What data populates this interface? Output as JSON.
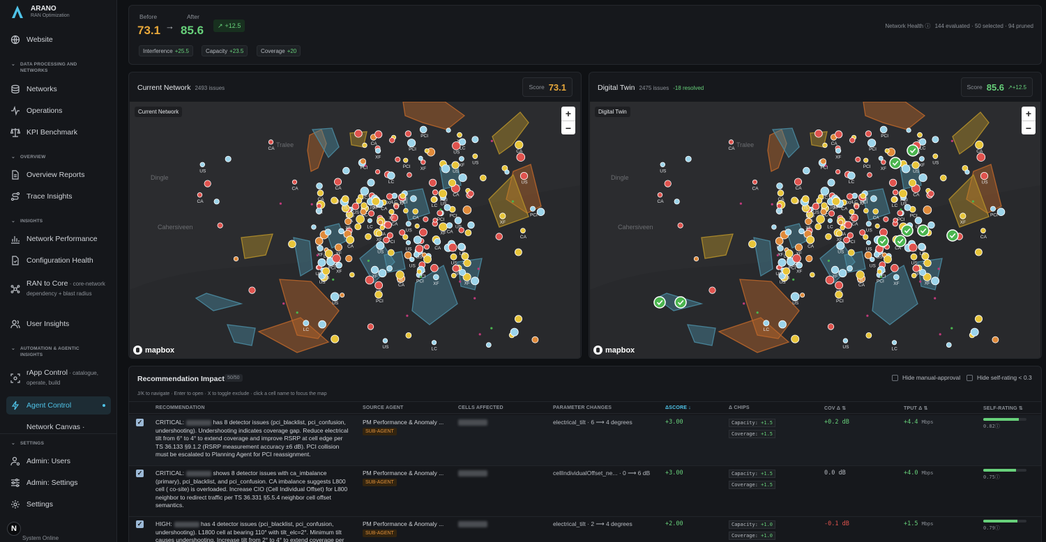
{
  "brand": {
    "name": "ARANO",
    "subtitle": "RAN Optimization"
  },
  "sidebar": {
    "website": "Website",
    "sections": [
      {
        "label": "DATA PROCESSING AND NETWORKS"
      },
      {
        "label": "OVERVIEW"
      },
      {
        "label": "INSIGHTS"
      },
      {
        "label": "AUTOMATION & AGENTIC INSIGHTS"
      },
      {
        "label": "SETTINGS"
      }
    ],
    "items": {
      "networks": "Networks",
      "operations": "Operations",
      "kpi": "KPI Benchmark",
      "overview_reports": "Overview Reports",
      "trace_insights": "Trace Insights",
      "network_performance": "Network Performance",
      "configuration_health": "Configuration Health",
      "ran_to_core": "RAN to Core",
      "ran_to_core_desc": " · core-network dependency + blast radius",
      "user_insights": "User Insights",
      "rapp_control": "rApp Control",
      "rapp_control_desc": " · catalogue, operate, build",
      "agent_control": "Agent Control",
      "network_canvas": "Network Canvas ·",
      "admin_users": "Admin: Users",
      "admin_settings": "Admin: Settings",
      "settings": "Settings"
    },
    "status": "System Online",
    "avatar": "N"
  },
  "summary": {
    "before_label": "Before",
    "before_value": "73.1",
    "after_label": "After",
    "after_value": "85.6",
    "delta": "+12.5",
    "chips": [
      {
        "label": "Interference",
        "value": "+25.5"
      },
      {
        "label": "Capacity",
        "value": "+23.5"
      },
      {
        "label": "Coverage",
        "value": "+20"
      }
    ],
    "network_health_label": "Network Health",
    "network_health_stats": "144 evaluated · 50 selected · 94 pruned"
  },
  "maps": {
    "current": {
      "title": "Current Network",
      "issues": "2493 issues",
      "score_label": "Score",
      "score": "73.1",
      "tag": "Current Network"
    },
    "twin": {
      "title": "Digital Twin",
      "issues": "2475 issues",
      "resolved": "-18 resolved",
      "score_label": "Score",
      "score": "85.6",
      "delta": "+12.5",
      "tag": "Digital Twin"
    },
    "place_labels": [
      "Tralee",
      "Dingle",
      "Cahersiveen"
    ],
    "zoom_in": "+",
    "zoom_out": "−",
    "attribution": "mapbox",
    "colors": {
      "red": "#e0534e",
      "orange": "#e08a3a",
      "yellow": "#e8c53a",
      "blue": "#9cd4ea",
      "green": "#4bb54f",
      "poly_blue": "#4a8aa0",
      "poly_yellow": "#b38f2a",
      "poly_orange": "#b8652a"
    }
  },
  "rec": {
    "title": "Recommendation Impact",
    "count": "50/50",
    "hint": "J/K to navigate · Enter to open · X to toggle exclude · click a cell name to focus the map",
    "hide_manual": "Hide manual-approval",
    "hide_self": "Hide self-rating < 0.3",
    "headers": {
      "recommendation": "RECOMMENDATION",
      "source": "SOURCE AGENT",
      "cells": "CELLS AFFECTED",
      "params": "PARAMETER CHANGES",
      "score": "ΔSCORE ↓",
      "chips": "Δ CHIPS",
      "cov": "COV Δ ⇅",
      "tput": "TPUT Δ ⇅",
      "self": "SELF-RATING ⇅"
    },
    "rows": [
      {
        "check": "✓",
        "prefix": "CRITICAL:",
        "text": " has 8 detector issues (pci_blacklist, pci_confusion, undershooting). Undershooting indicates coverage gap. Reduce electrical tilt from 6° to 4° to extend coverage and improve RSRP at cell edge per TS 36.133 §9.1.2 (RSRP measurement accuracy ±6 dB). PCI collision must be escalated to Planning Agent for PCI reassignment.",
        "agent": "PM Performance & Anomaly ...",
        "sub": "SUB-AGENT",
        "param": "electrical_tilt · 6 ⟶ 4 degrees",
        "score": "+3.00",
        "chip1_label": "Capacity:",
        "chip1_value": "+1.5",
        "chip2_label": "Coverage:",
        "chip2_value": "+1.5",
        "cov": "+0.2 dB",
        "cov_color": "#67d07a",
        "tput": "+4.4",
        "tput_unit": "Mbps",
        "self": "0.82",
        "self_level": 0.82
      },
      {
        "check": "✓",
        "prefix": "CRITICAL:",
        "text": " shows 8 detector issues with ca_imbalance (primary), pci_blacklist, and pci_confusion. CA imbalance suggests L800 cell (                    co-site) is overloaded. Increase CIO (Cell Individual Offset) for L800 neighbor to redirect traffic per TS 36.331 §5.5.4 neighbor cell offset semantics.",
        "agent": "PM Performance & Anomaly ...",
        "sub": "SUB-AGENT",
        "param": "cellIndividualOffset_ne... · 0 ⟶ 6 dB",
        "score": "+3.00",
        "chip1_label": "Capacity:",
        "chip1_value": "+1.5",
        "chip2_label": "Coverage:",
        "chip2_value": "+1.5",
        "cov": "0.0 dB",
        "cov_color": "#b6bac0",
        "tput": "+4.0",
        "tput_unit": "Mbps",
        "self": "0.75",
        "self_level": 0.75
      },
      {
        "check": "✓",
        "prefix": "HIGH:",
        "text": " has 4 detector issues (pci_blacklist, pci_confusion, undershooting). L1800 cell at bearing 110° with tilt_elc=2°. Minimum tilt causes undershooting. Increase tilt from 2° to 4° to extend coverage per",
        "agent": "PM Performance & Anomaly ...",
        "sub": "SUB-AGENT",
        "param": "electrical_tilt · 2 ⟶ 4 degrees",
        "score": "+2.00",
        "chip1_label": "Capacity:",
        "chip1_value": "+1.0",
        "chip2_label": "Coverage:",
        "chip2_value": "+1.0",
        "cov": "-0.1 dB",
        "cov_color": "#e0534e",
        "tput": "+1.5",
        "tput_unit": "Mbps",
        "self": "0.79",
        "self_level": 0.79
      }
    ]
  }
}
